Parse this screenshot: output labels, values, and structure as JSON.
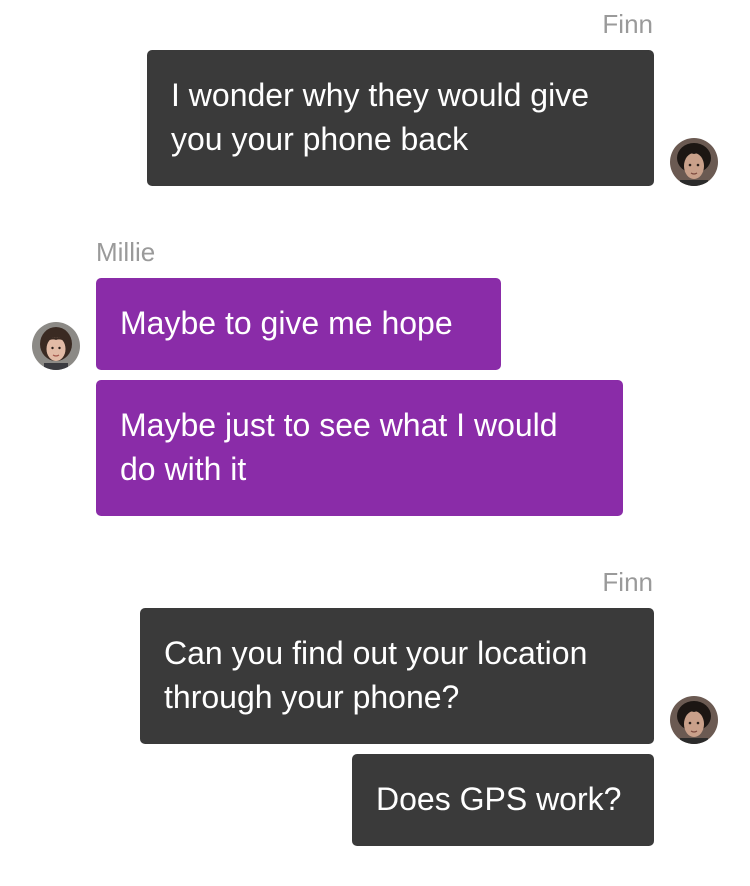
{
  "conversation": {
    "messages": [
      {
        "sender": "Finn",
        "text": "I wonder why they would give you your phone back"
      },
      {
        "sender": "Millie",
        "text": "Maybe to give me hope"
      },
      {
        "sender": "Millie",
        "text": "Maybe just to see what I would do with it"
      },
      {
        "sender": "Finn",
        "text": "Can you find out your location through your phone?"
      },
      {
        "sender": "Finn",
        "text": "Does GPS work?"
      }
    ],
    "groups": [
      {
        "sender": "Finn",
        "avatar": "finn-avatar"
      },
      {
        "sender": "Millie",
        "avatar": "millie-avatar"
      },
      {
        "sender": "Finn",
        "avatar": "finn-avatar"
      }
    ]
  },
  "colors": {
    "outgoing_bubble": "#3a3a3a",
    "incoming_bubble": "#8a2ca8",
    "sender_label": "#9a9a9a",
    "bubble_text": "#ffffff"
  }
}
